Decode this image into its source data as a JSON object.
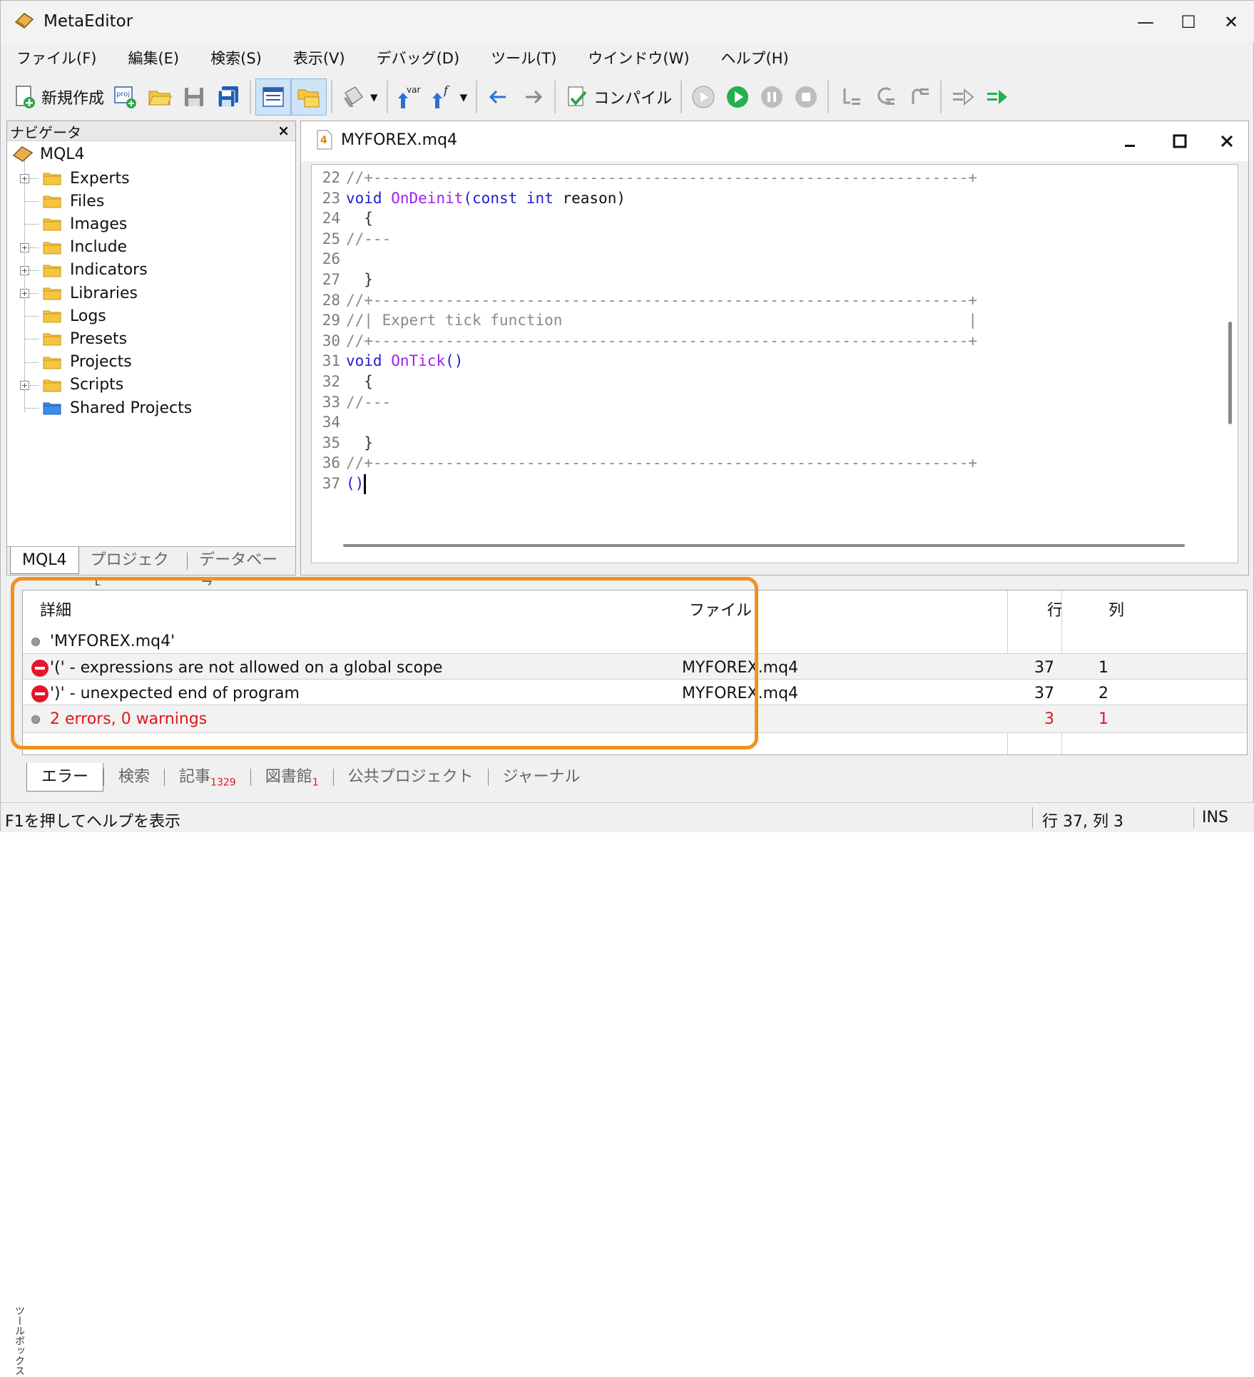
{
  "window": {
    "title": "MetaEditor",
    "minimize_glyph": "—",
    "maximize_glyph": "☐",
    "close_glyph": "✕"
  },
  "menu": [
    "ファイル(F)",
    "編集(E)",
    "検索(S)",
    "表示(V)",
    "デバッグ(D)",
    "ツール(T)",
    "ウインドウ(W)",
    "ヘルプ(H)"
  ],
  "toolbar": {
    "new_label": "新規作成",
    "proj_icon_text": "proj",
    "var_icon_text": "var",
    "fn_icon_text": "f",
    "compile_label": "コンパイル"
  },
  "navigator": {
    "title": "ナビゲータ",
    "close_glyph": "×",
    "root": "MQL4",
    "items": [
      {
        "label": "Experts",
        "expandable": true
      },
      {
        "label": "Files",
        "expandable": false
      },
      {
        "label": "Images",
        "expandable": false
      },
      {
        "label": "Include",
        "expandable": true
      },
      {
        "label": "Indicators",
        "expandable": true
      },
      {
        "label": "Libraries",
        "expandable": true
      },
      {
        "label": "Logs",
        "expandable": false
      },
      {
        "label": "Presets",
        "expandable": false
      },
      {
        "label": "Projects",
        "expandable": false
      },
      {
        "label": "Scripts",
        "expandable": true
      },
      {
        "label": "Shared Projects",
        "expandable": false
      }
    ],
    "tabs": [
      "MQL4",
      "プロジェクト",
      "データベース"
    ]
  },
  "editor": {
    "file_name": "MYFOREX.mq4",
    "file_icon_glyph": "4",
    "lines": [
      {
        "n": "22",
        "html": "<span class=\"cm\">//+------------------------------------------------------------------+</span>"
      },
      {
        "n": "23",
        "html": "<span class=\"kw\">void</span> <span class=\"fn\">OnDeinit</span><span class=\"kw\">(const</span> <span class=\"kw\">int</span> reason)"
      },
      {
        "n": "24",
        "html": "  <span class=\"br\">{</span>"
      },
      {
        "n": "25",
        "html": "<span class=\"cm\">//---</span>"
      },
      {
        "n": "26",
        "html": ""
      },
      {
        "n": "27",
        "html": "  <span class=\"br\">}</span>"
      },
      {
        "n": "28",
        "html": "<span class=\"cm\">//+------------------------------------------------------------------+</span>"
      },
      {
        "n": "29",
        "html": "<span class=\"cm\">//| Expert tick function                                             |</span>"
      },
      {
        "n": "30",
        "html": "<span class=\"cm\">//+------------------------------------------------------------------+</span>"
      },
      {
        "n": "31",
        "html": "<span class=\"kw\">void</span> <span class=\"fn\">OnTick</span><span class=\"kw\">()</span>"
      },
      {
        "n": "32",
        "html": "  <span class=\"br\">{</span>"
      },
      {
        "n": "33",
        "html": "<span class=\"cm\">//---</span>"
      },
      {
        "n": "34",
        "html": ""
      },
      {
        "n": "35",
        "html": "  <span class=\"br\">}</span>"
      },
      {
        "n": "36",
        "html": "<span class=\"cm\">//+------------------------------------------------------------------+</span>"
      },
      {
        "n": "37",
        "html": "<span class=\"kw\">()</span><span class=\"caret\"></span>"
      }
    ]
  },
  "errors": {
    "columns": {
      "detail": "詳細",
      "file": "ファイル",
      "line": "行",
      "col": "列"
    },
    "rows": [
      {
        "type": "info",
        "detail": "'MYFOREX.mq4'",
        "file": "",
        "line": "",
        "col": ""
      },
      {
        "type": "error",
        "detail": "'(' - expressions are not allowed on a global scope",
        "file": "MYFOREX.mq4",
        "line": "37",
        "col": "1"
      },
      {
        "type": "error",
        "detail": "')' - unexpected end of program",
        "file": "MYFOREX.mq4",
        "line": "37",
        "col": "2"
      },
      {
        "type": "summary",
        "detail": "2 errors, 0 warnings",
        "file": "",
        "line": "3",
        "col": "1"
      }
    ],
    "tabs": [
      {
        "label": "エラー",
        "badge": ""
      },
      {
        "label": "検索",
        "badge": ""
      },
      {
        "label": "記事",
        "badge": "1329"
      },
      {
        "label": "図書館",
        "badge": "1"
      },
      {
        "label": "公共プロジェクト",
        "badge": ""
      },
      {
        "label": "ジャーナル",
        "badge": ""
      }
    ],
    "side_label": "ツールボックス"
  },
  "status": {
    "help": "F1を押してヘルプを表示",
    "position": "行 37, 列 3",
    "mode": "INS"
  },
  "colors": {
    "accent_highlight": "#f0921c",
    "error_red": "#e0161e",
    "keyword_blue": "#1f1fd1",
    "function_purple": "#a020f0"
  }
}
